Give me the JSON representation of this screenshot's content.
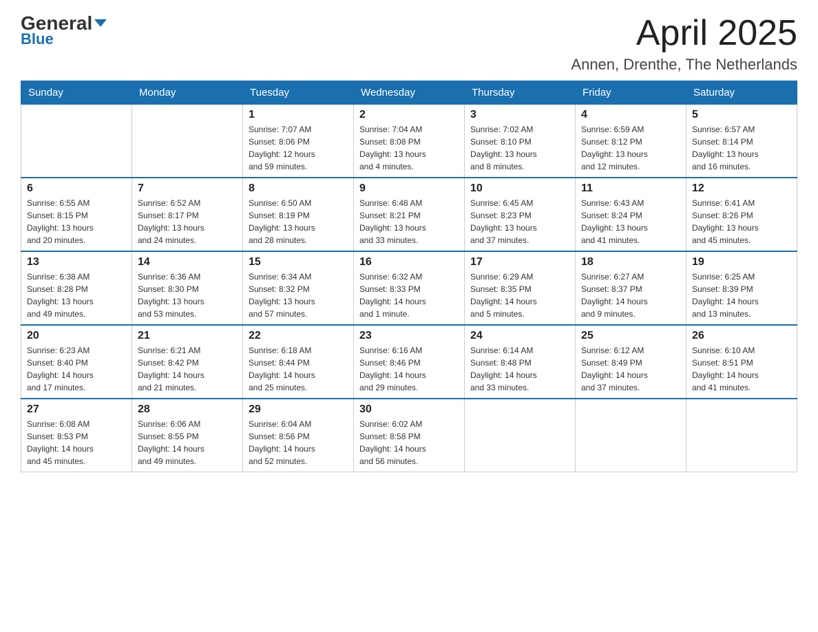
{
  "header": {
    "logo_general": "General",
    "logo_blue": "Blue",
    "month_title": "April 2025",
    "subtitle": "Annen, Drenthe, The Netherlands"
  },
  "days_of_week": [
    "Sunday",
    "Monday",
    "Tuesday",
    "Wednesday",
    "Thursday",
    "Friday",
    "Saturday"
  ],
  "weeks": [
    [
      {
        "day": "",
        "info": ""
      },
      {
        "day": "",
        "info": ""
      },
      {
        "day": "1",
        "info": "Sunrise: 7:07 AM\nSunset: 8:06 PM\nDaylight: 12 hours\nand 59 minutes."
      },
      {
        "day": "2",
        "info": "Sunrise: 7:04 AM\nSunset: 8:08 PM\nDaylight: 13 hours\nand 4 minutes."
      },
      {
        "day": "3",
        "info": "Sunrise: 7:02 AM\nSunset: 8:10 PM\nDaylight: 13 hours\nand 8 minutes."
      },
      {
        "day": "4",
        "info": "Sunrise: 6:59 AM\nSunset: 8:12 PM\nDaylight: 13 hours\nand 12 minutes."
      },
      {
        "day": "5",
        "info": "Sunrise: 6:57 AM\nSunset: 8:14 PM\nDaylight: 13 hours\nand 16 minutes."
      }
    ],
    [
      {
        "day": "6",
        "info": "Sunrise: 6:55 AM\nSunset: 8:15 PM\nDaylight: 13 hours\nand 20 minutes."
      },
      {
        "day": "7",
        "info": "Sunrise: 6:52 AM\nSunset: 8:17 PM\nDaylight: 13 hours\nand 24 minutes."
      },
      {
        "day": "8",
        "info": "Sunrise: 6:50 AM\nSunset: 8:19 PM\nDaylight: 13 hours\nand 28 minutes."
      },
      {
        "day": "9",
        "info": "Sunrise: 6:48 AM\nSunset: 8:21 PM\nDaylight: 13 hours\nand 33 minutes."
      },
      {
        "day": "10",
        "info": "Sunrise: 6:45 AM\nSunset: 8:23 PM\nDaylight: 13 hours\nand 37 minutes."
      },
      {
        "day": "11",
        "info": "Sunrise: 6:43 AM\nSunset: 8:24 PM\nDaylight: 13 hours\nand 41 minutes."
      },
      {
        "day": "12",
        "info": "Sunrise: 6:41 AM\nSunset: 8:26 PM\nDaylight: 13 hours\nand 45 minutes."
      }
    ],
    [
      {
        "day": "13",
        "info": "Sunrise: 6:38 AM\nSunset: 8:28 PM\nDaylight: 13 hours\nand 49 minutes."
      },
      {
        "day": "14",
        "info": "Sunrise: 6:36 AM\nSunset: 8:30 PM\nDaylight: 13 hours\nand 53 minutes."
      },
      {
        "day": "15",
        "info": "Sunrise: 6:34 AM\nSunset: 8:32 PM\nDaylight: 13 hours\nand 57 minutes."
      },
      {
        "day": "16",
        "info": "Sunrise: 6:32 AM\nSunset: 8:33 PM\nDaylight: 14 hours\nand 1 minute."
      },
      {
        "day": "17",
        "info": "Sunrise: 6:29 AM\nSunset: 8:35 PM\nDaylight: 14 hours\nand 5 minutes."
      },
      {
        "day": "18",
        "info": "Sunrise: 6:27 AM\nSunset: 8:37 PM\nDaylight: 14 hours\nand 9 minutes."
      },
      {
        "day": "19",
        "info": "Sunrise: 6:25 AM\nSunset: 8:39 PM\nDaylight: 14 hours\nand 13 minutes."
      }
    ],
    [
      {
        "day": "20",
        "info": "Sunrise: 6:23 AM\nSunset: 8:40 PM\nDaylight: 14 hours\nand 17 minutes."
      },
      {
        "day": "21",
        "info": "Sunrise: 6:21 AM\nSunset: 8:42 PM\nDaylight: 14 hours\nand 21 minutes."
      },
      {
        "day": "22",
        "info": "Sunrise: 6:18 AM\nSunset: 8:44 PM\nDaylight: 14 hours\nand 25 minutes."
      },
      {
        "day": "23",
        "info": "Sunrise: 6:16 AM\nSunset: 8:46 PM\nDaylight: 14 hours\nand 29 minutes."
      },
      {
        "day": "24",
        "info": "Sunrise: 6:14 AM\nSunset: 8:48 PM\nDaylight: 14 hours\nand 33 minutes."
      },
      {
        "day": "25",
        "info": "Sunrise: 6:12 AM\nSunset: 8:49 PM\nDaylight: 14 hours\nand 37 minutes."
      },
      {
        "day": "26",
        "info": "Sunrise: 6:10 AM\nSunset: 8:51 PM\nDaylight: 14 hours\nand 41 minutes."
      }
    ],
    [
      {
        "day": "27",
        "info": "Sunrise: 6:08 AM\nSunset: 8:53 PM\nDaylight: 14 hours\nand 45 minutes."
      },
      {
        "day": "28",
        "info": "Sunrise: 6:06 AM\nSunset: 8:55 PM\nDaylight: 14 hours\nand 49 minutes."
      },
      {
        "day": "29",
        "info": "Sunrise: 6:04 AM\nSunset: 8:56 PM\nDaylight: 14 hours\nand 52 minutes."
      },
      {
        "day": "30",
        "info": "Sunrise: 6:02 AM\nSunset: 8:58 PM\nDaylight: 14 hours\nand 56 minutes."
      },
      {
        "day": "",
        "info": ""
      },
      {
        "day": "",
        "info": ""
      },
      {
        "day": "",
        "info": ""
      }
    ]
  ]
}
